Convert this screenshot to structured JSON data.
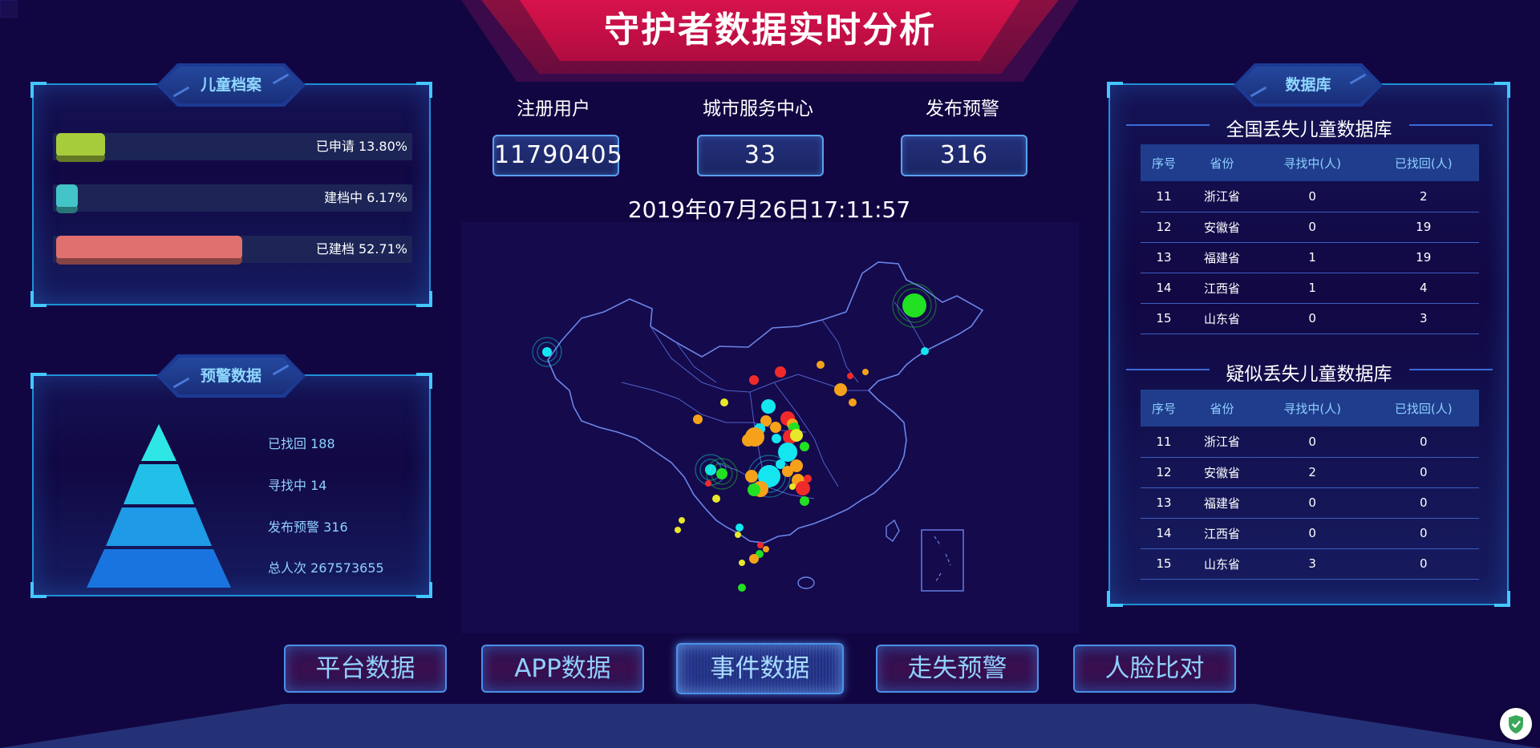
{
  "header": {
    "title": "守护者数据实时分析"
  },
  "children_archive": {
    "badge": "儿童档案",
    "bars": [
      {
        "label": "已申请 13.80%",
        "percent": 13.8,
        "color": "#a6cc3c"
      },
      {
        "label": "建档中 6.17%",
        "percent": 6.17,
        "color": "#43c4c8"
      },
      {
        "label": "已建档 52.71%",
        "percent": 52.71,
        "color": "#e07070"
      }
    ]
  },
  "warning_data": {
    "badge": "预警数据",
    "legend": [
      "已找回 188",
      "寻找中 14",
      "发布预警 316",
      "总人次 267573655"
    ],
    "colors": [
      "#2ee6e6",
      "#22c0e8",
      "#1e9ae6",
      "#1a74e0"
    ]
  },
  "stats": [
    {
      "label": "注册用户",
      "value": "11790405"
    },
    {
      "label": "城市服务中心",
      "value": "33"
    },
    {
      "label": "发布预警",
      "value": "316"
    }
  ],
  "datetime": "2019年07月26日17:11:57",
  "database": {
    "badge": "数据库",
    "tables": [
      {
        "title": "全国丢失儿童数据库",
        "headers": [
          "序号",
          "省份",
          "寻找中(人)",
          "已找回(人)"
        ],
        "rows": [
          [
            "11",
            "浙江省",
            "0",
            "2"
          ],
          [
            "12",
            "安徽省",
            "0",
            "19"
          ],
          [
            "13",
            "福建省",
            "1",
            "19"
          ],
          [
            "14",
            "江西省",
            "1",
            "4"
          ],
          [
            "15",
            "山东省",
            "0",
            "3"
          ]
        ]
      },
      {
        "title": "疑似丢失儿童数据库",
        "headers": [
          "序号",
          "省份",
          "寻找中(人)",
          "已找回(人)"
        ],
        "rows": [
          [
            "11",
            "浙江省",
            "0",
            "0"
          ],
          [
            "12",
            "安徽省",
            "2",
            "0"
          ],
          [
            "13",
            "福建省",
            "0",
            "0"
          ],
          [
            "14",
            "江西省",
            "0",
            "0"
          ],
          [
            "15",
            "山东省",
            "3",
            "0"
          ]
        ]
      }
    ]
  },
  "nav": [
    {
      "label": "平台数据",
      "active": false
    },
    {
      "label": "APP数据",
      "active": false
    },
    {
      "label": "事件数据",
      "active": true
    },
    {
      "label": "走失预警",
      "active": false
    },
    {
      "label": "人脸比对",
      "active": false
    }
  ],
  "map": {
    "region": "China",
    "point_colors": {
      "green": "#22e022",
      "cyan": "#14e6f0",
      "orange": "#f5a21a",
      "red": "#f02a2a",
      "yellow": "#e8e82a"
    }
  }
}
